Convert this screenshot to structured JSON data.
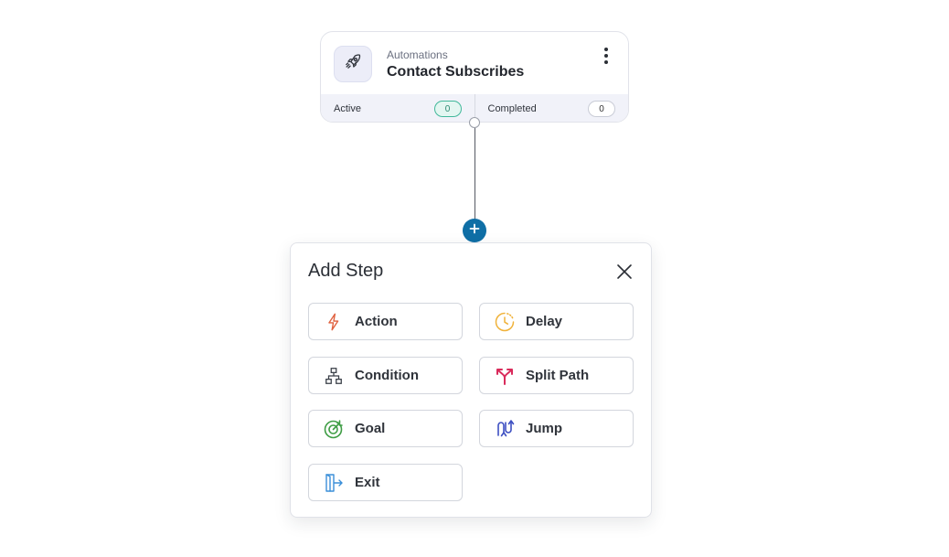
{
  "trigger": {
    "kicker": "Automations",
    "title": "Contact Subscribes",
    "icon": "rocket-icon",
    "stats": {
      "active_label": "Active",
      "active_count": "0",
      "completed_label": "Completed",
      "completed_count": "0"
    }
  },
  "add_step": {
    "title": "Add Step",
    "options": [
      {
        "label": "Action",
        "icon": "lightning-icon",
        "color": "#e0613f"
      },
      {
        "label": "Delay",
        "icon": "clock-icon",
        "color": "#f0b23a"
      },
      {
        "label": "Condition",
        "icon": "hierarchy-icon",
        "color": "#3a3f48"
      },
      {
        "label": "Split Path",
        "icon": "split-arrows-icon",
        "color": "#d92b5b"
      },
      {
        "label": "Goal",
        "icon": "target-icon",
        "color": "#3f9d45"
      },
      {
        "label": "Jump",
        "icon": "jump-arrows-icon",
        "color": "#3d4fc2"
      },
      {
        "label": "Exit",
        "icon": "exit-door-icon",
        "color": "#3b8fd9"
      }
    ]
  },
  "colors": {
    "accent": "#0f6fa6",
    "active_badge": "#41b89a"
  }
}
